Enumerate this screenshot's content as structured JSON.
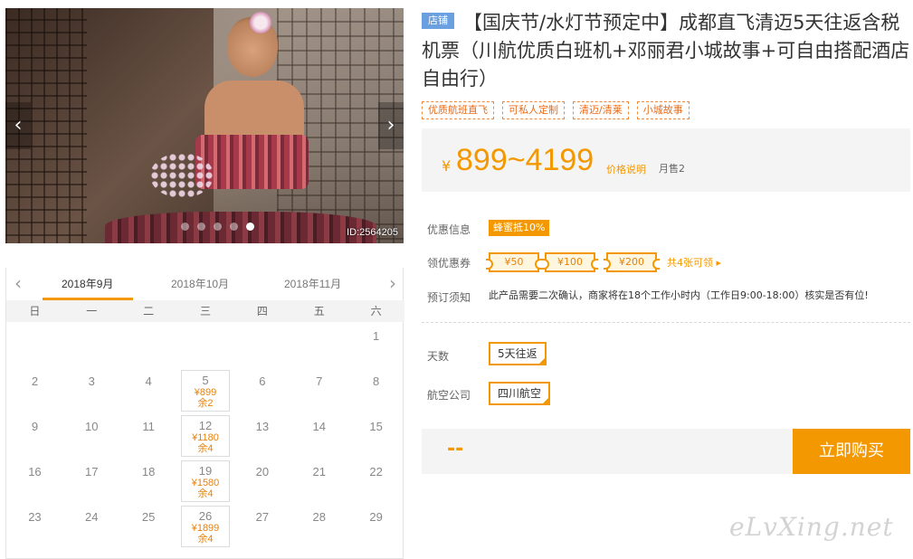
{
  "gallery": {
    "photo_id": "ID:2564205",
    "prev_icon": "chevron-left-icon",
    "next_icon": "chevron-right-icon",
    "dot_count": 5,
    "active_dot": 4
  },
  "calendar": {
    "months": [
      "2018年9月",
      "2018年10月",
      "2018年11月"
    ],
    "active_month": 0,
    "weekdays": [
      "日",
      "一",
      "二",
      "三",
      "四",
      "五",
      "六"
    ],
    "weeks": [
      [
        null,
        null,
        null,
        null,
        null,
        null,
        {
          "day": "1"
        }
      ],
      [
        {
          "day": "2"
        },
        {
          "day": "3"
        },
        {
          "day": "4"
        },
        {
          "day": "5",
          "price": "¥899",
          "stock": "余2"
        },
        {
          "day": "6"
        },
        {
          "day": "7"
        },
        {
          "day": "8"
        }
      ],
      [
        {
          "day": "9"
        },
        {
          "day": "10"
        },
        {
          "day": "11"
        },
        {
          "day": "12",
          "price": "¥1180",
          "stock": "余4"
        },
        {
          "day": "13"
        },
        {
          "day": "14"
        },
        {
          "day": "15"
        }
      ],
      [
        {
          "day": "16"
        },
        {
          "day": "17"
        },
        {
          "day": "18"
        },
        {
          "day": "19",
          "price": "¥1580",
          "stock": "余4"
        },
        {
          "day": "20"
        },
        {
          "day": "21"
        },
        {
          "day": "22"
        }
      ],
      [
        {
          "day": "23"
        },
        {
          "day": "24"
        },
        {
          "day": "25"
        },
        {
          "day": "26",
          "price": "¥1899",
          "stock": "余4"
        },
        {
          "day": "27"
        },
        {
          "day": "28"
        },
        {
          "day": "29"
        }
      ]
    ]
  },
  "product": {
    "shop_badge": "店铺",
    "title": "【国庆节/水灯节预定中】成都直飞清迈5天往返含税机票（川航优质白班机+邓丽君小城故事+可自由搭配酒店自由行）",
    "tags": [
      "优质航班直飞",
      "可私人定制",
      "清迈/清莱",
      "小城故事"
    ]
  },
  "price": {
    "currency": "¥",
    "range": "899~4199",
    "explain": "价格说明",
    "monthly_sales": "月售2"
  },
  "promotions": {
    "discount_label": "优惠信息",
    "discount_badge": "蜂蜜抵10%",
    "coupon_label": "领优惠券",
    "coupons": [
      "¥50",
      "¥100",
      "¥200"
    ],
    "coupon_more": "共4张可领 ▸",
    "notice_label": "预订须知",
    "notice_text": "此产品需要二次确认，商家将在18个工作小时内（工作日9:00-18:00）核实是否有位!"
  },
  "options": {
    "days_label": "天数",
    "days_value": "5天往返",
    "airline_label": "航空公司",
    "airline_value": "四川航空"
  },
  "purchase": {
    "total": "--",
    "buy_label": "立即购买"
  },
  "watermark": "eLvXing.net",
  "colors": {
    "accent": "#f39800",
    "badge_blue": "#6a9fe0",
    "tag_orange": "#e86b1a"
  }
}
